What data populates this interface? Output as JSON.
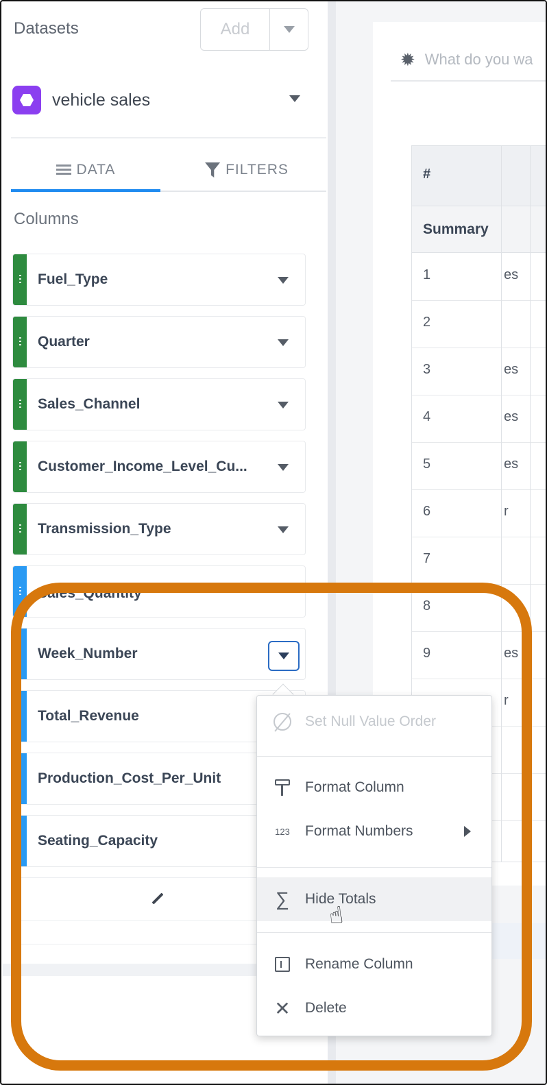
{
  "sidebar": {
    "title": "Datasets",
    "add_label": "Add",
    "dataset_name": "vehicle sales",
    "tabs": [
      {
        "label": "DATA",
        "icon": "list-icon",
        "active": true
      },
      {
        "label": "FILTERS",
        "icon": "filter-icon",
        "active": false
      }
    ],
    "columns_label": "Columns",
    "columns": [
      {
        "label": "Fuel_Type",
        "type": "dimension"
      },
      {
        "label": "Quarter",
        "type": "dimension"
      },
      {
        "label": "Sales_Channel",
        "type": "dimension"
      },
      {
        "label": "Customer_Income_Level_Cu...",
        "type": "dimension"
      },
      {
        "label": "Transmission_Type",
        "type": "dimension"
      },
      {
        "label": "Sales_Quantity",
        "type": "measure"
      },
      {
        "label": "Week_Number",
        "type": "measure"
      },
      {
        "label": "Total_Revenue",
        "type": "measure"
      },
      {
        "label": "Production_Cost_Per_Unit",
        "type": "measure"
      },
      {
        "label": "Seating_Capacity",
        "type": "measure"
      }
    ]
  },
  "query": {
    "placeholder": "What do you wa"
  },
  "table": {
    "header": "#",
    "summary_label": "Summary",
    "rows": [
      {
        "num": "1",
        "frag": "es"
      },
      {
        "num": "2",
        "frag": ""
      },
      {
        "num": "3",
        "frag": "es"
      },
      {
        "num": "4",
        "frag": "es"
      },
      {
        "num": "5",
        "frag": "es"
      },
      {
        "num": "6",
        "frag": "r"
      },
      {
        "num": "7",
        "frag": ""
      },
      {
        "num": "8",
        "frag": ""
      },
      {
        "num": "9",
        "frag": "es"
      },
      {
        "num": "",
        "frag": "r"
      },
      {
        "num": "",
        "frag": ""
      },
      {
        "num": "",
        "frag": ""
      },
      {
        "num": "",
        "frag": ""
      }
    ]
  },
  "context_menu": {
    "items": [
      {
        "label": "Set Null Value Order",
        "icon": "null-order-icon",
        "disabled": true
      },
      {
        "label": "Format Column",
        "icon": "paint-roller-icon",
        "disabled": false
      },
      {
        "label": "Format Numbers",
        "icon": "number-format-icon",
        "icon_text": "123",
        "disabled": false,
        "submenu": true
      },
      {
        "label": "Hide Totals",
        "icon": "sigma-icon",
        "icon_text": "∑",
        "disabled": false,
        "hovered": true
      },
      {
        "label": "Rename Column",
        "icon": "rename-icon",
        "disabled": false
      },
      {
        "label": "Delete",
        "icon": "delete-icon",
        "icon_text": "✕",
        "disabled": false
      }
    ]
  },
  "colors": {
    "dimension": "#2e8b3f",
    "measure": "#2a9af3",
    "dataset_icon": "#8b3ff0",
    "active_tab": "#1f8bf0",
    "highlight": "#d7780d"
  }
}
